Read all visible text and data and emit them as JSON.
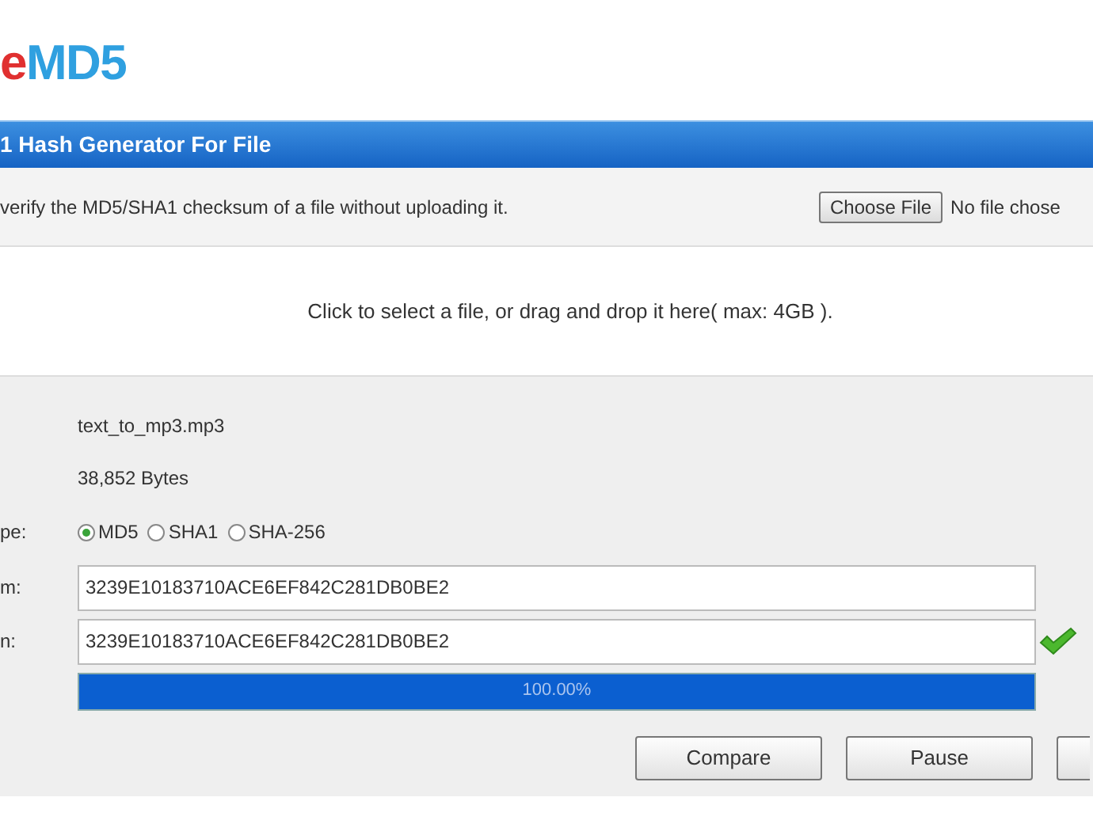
{
  "logo": {
    "accent": "e",
    "main": "MD5"
  },
  "header": {
    "title": "1 Hash Generator For File"
  },
  "intro": {
    "text": "verify the MD5/SHA1 checksum of a file without uploading it.",
    "button": "Choose File",
    "file_status": "No file chose"
  },
  "drop_zone": {
    "text": "Click to select a file, or drag and drop it here( max: 4GB )."
  },
  "file_name": "text_to_mp3.mp3",
  "file_size": "38,852 Bytes",
  "hash_type": {
    "label": "pe:",
    "options": [
      {
        "label": "MD5",
        "selected": true
      },
      {
        "label": "SHA1",
        "selected": false
      },
      {
        "label": "SHA-256",
        "selected": false
      }
    ]
  },
  "hash_rows": [
    {
      "label": "m:",
      "value": "3239E10183710ACE6EF842C281DB0BE2",
      "matched": false
    },
    {
      "label": "n:",
      "value": "3239E10183710ACE6EF842C281DB0BE2",
      "matched": true
    }
  ],
  "progress": {
    "level": 1.0,
    "text": "100.00%"
  },
  "buttons": [
    {
      "kind": "labeled",
      "label": "Compare"
    },
    {
      "kind": "labeled",
      "label": "Pause"
    },
    {
      "kind": "cut_off"
    }
  ]
}
